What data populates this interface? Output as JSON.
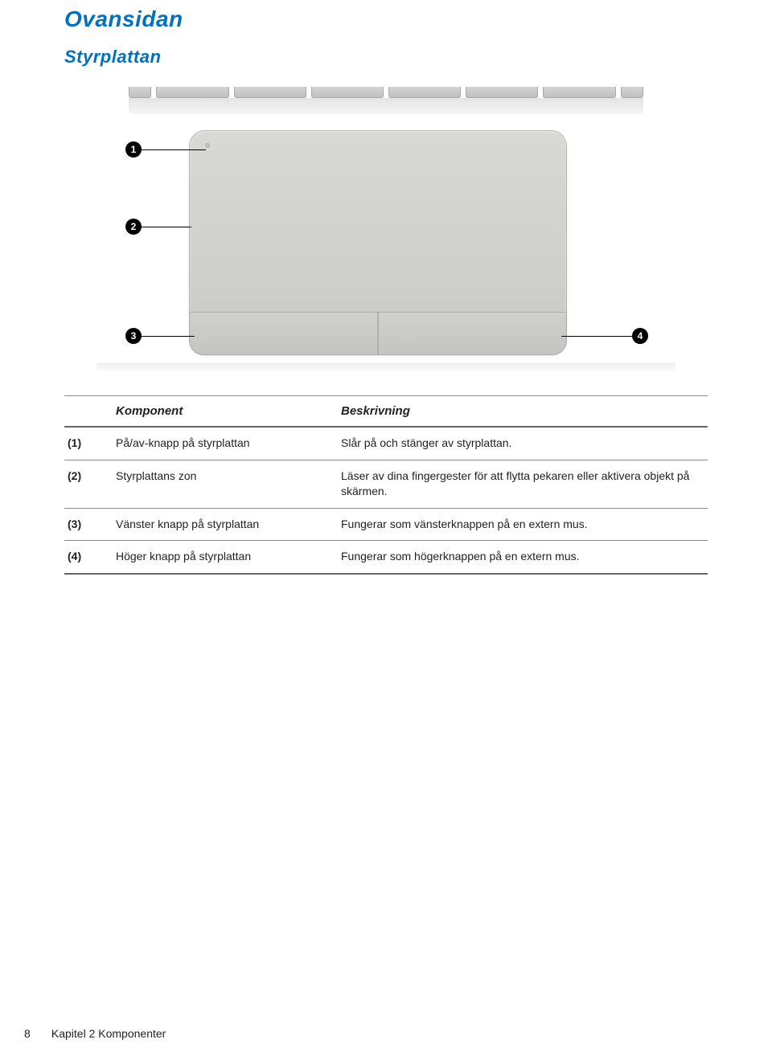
{
  "heading": "Ovansidan",
  "subheading": "Styrplattan",
  "callouts": {
    "1": "1",
    "2": "2",
    "3": "3",
    "4": "4"
  },
  "table": {
    "header_component": "Komponent",
    "header_description": "Beskrivning",
    "rows": [
      {
        "num": "(1)",
        "component": "På/av-knapp på styrplattan",
        "description": "Slår på och stänger av styrplattan."
      },
      {
        "num": "(2)",
        "component": "Styrplattans zon",
        "description": "Läser av dina fingergester för att flytta pekaren eller aktivera objekt på skärmen."
      },
      {
        "num": "(3)",
        "component": "Vänster knapp på styrplattan",
        "description": "Fungerar som vänsterknappen på en extern mus."
      },
      {
        "num": "(4)",
        "component": "Höger knapp på styrplattan",
        "description": "Fungerar som högerknappen på en extern mus."
      }
    ]
  },
  "footer": {
    "page_number": "8",
    "chapter": "Kapitel 2   Komponenter"
  }
}
